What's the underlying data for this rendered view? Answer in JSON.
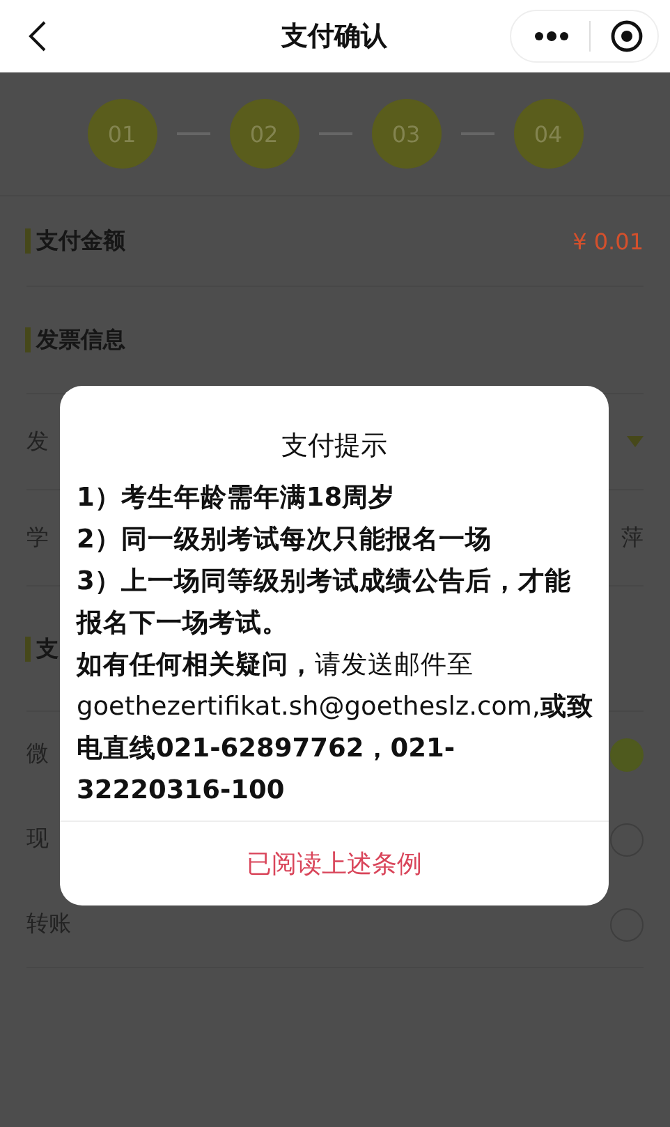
{
  "header": {
    "title": "支付确认"
  },
  "steps": [
    "01",
    "02",
    "03",
    "04"
  ],
  "amount": {
    "label": "支付金额",
    "value": "¥ 0.01"
  },
  "invoice": {
    "heading": "发票信息",
    "rows": [
      {
        "kind": "select",
        "label": "发"
      },
      {
        "kind": "text",
        "label": "学",
        "value": "萍"
      }
    ]
  },
  "payment": {
    "heading": "支",
    "options": [
      {
        "label": "微",
        "selected": true
      },
      {
        "label": "现",
        "selected": false
      },
      {
        "label": "转账",
        "selected": false
      }
    ]
  },
  "dialog": {
    "title": "支付提示",
    "rules": [
      "1）考生年龄需年满18周岁",
      "2）同一级别考试每次只能报名一场",
      "3）上一场同等级别考试成绩公告后，才能报名下一场考试。"
    ],
    "contact": "**如有任何相关疑问，**请发送邮件至goethezertifikat.sh@goetheslz.com,**或致电直线021-62897762，021-32220316-100**",
    "button": "已阅读上述条例"
  }
}
